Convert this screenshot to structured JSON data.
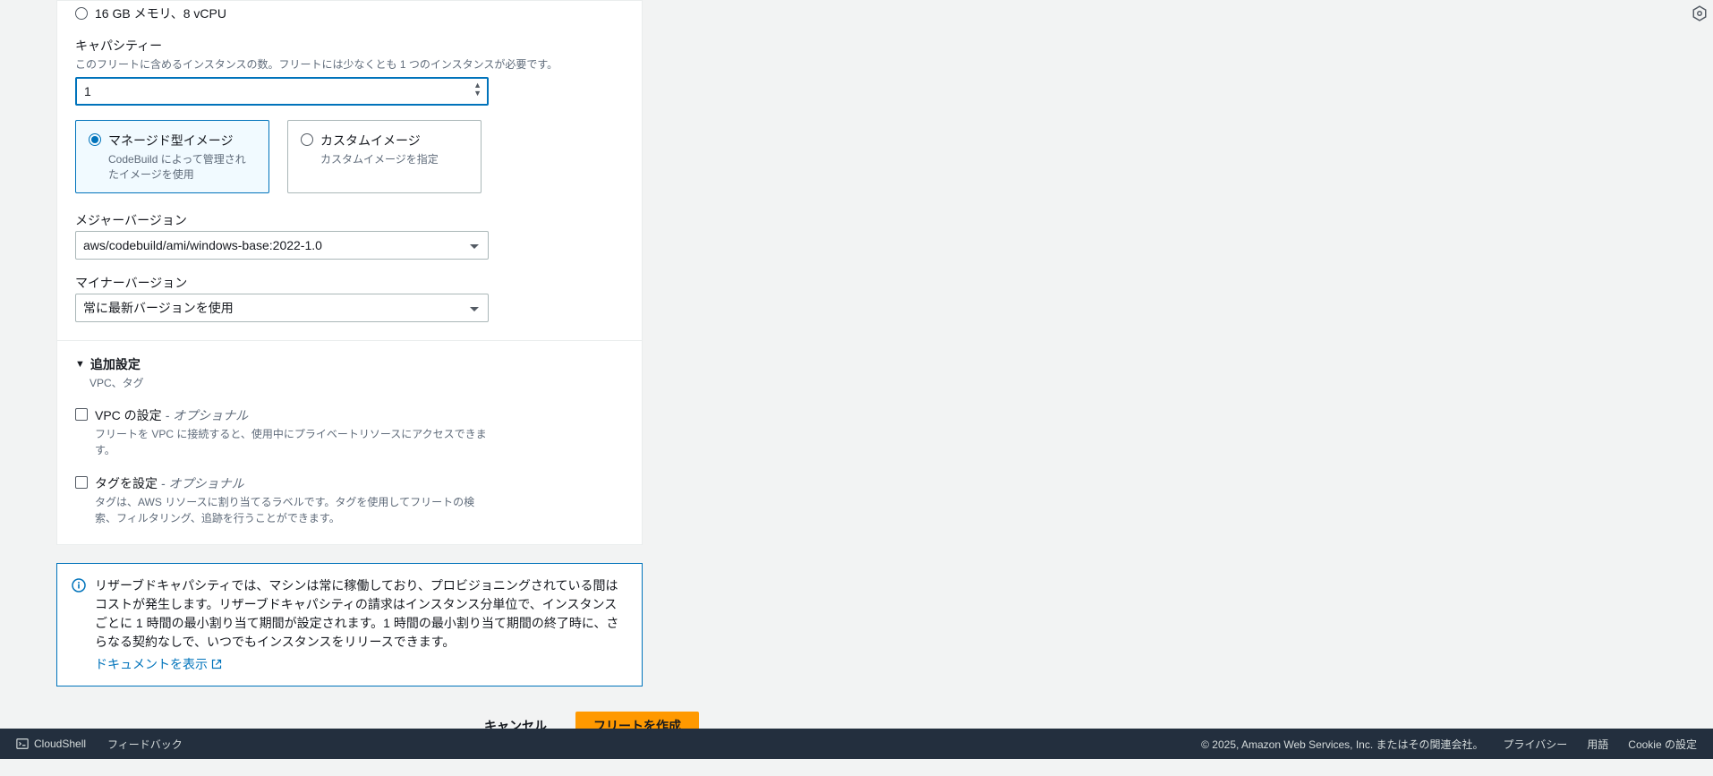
{
  "memory_option": "16 GB メモリ、8 vCPU",
  "capacity": {
    "label": "キャパシティー",
    "hint": "このフリートに含めるインスタンスの数。フリートには少なくとも 1 つのインスタンスが必要です。",
    "value": "1"
  },
  "image_tiles": {
    "managed": {
      "title": "マネージド型イメージ",
      "desc": "CodeBuild によって管理されたイメージを使用"
    },
    "custom": {
      "title": "カスタムイメージ",
      "desc": "カスタムイメージを指定"
    }
  },
  "major": {
    "label": "メジャーバージョン",
    "value": "aws/codebuild/ami/windows-base:2022-1.0"
  },
  "minor": {
    "label": "マイナーバージョン",
    "value": "常に最新バージョンを使用"
  },
  "additional": {
    "title": "追加設定",
    "sub": "VPC、タグ"
  },
  "vpc": {
    "label": "VPC の設定",
    "optional": " - オプショナル",
    "desc": "フリートを VPC に接続すると、使用中にプライベートリソースにアクセスできます。"
  },
  "tags": {
    "label": "タグを設定",
    "optional": " - オプショナル",
    "desc": "タグは、AWS リソースに割り当てるラベルです。タグを使用してフリートの検索、フィルタリング、追跡を行うことができます。"
  },
  "info": {
    "text": "リザーブドキャパシティでは、マシンは常に稼働しており、プロビジョニングされている間はコストが発生します。リザーブドキャパシティの請求はインスタンス分単位で、インスタンスごとに 1 時間の最小割り当て期間が設定されます。1 時間の最小割り当て期間の終了時に、さらなる契約なしで、いつでもインスタンスをリリースできます。",
    "link": "ドキュメントを表示"
  },
  "buttons": {
    "cancel": "キャンセル",
    "create": "フリートを作成"
  },
  "footer": {
    "cloudshell": "CloudShell",
    "feedback": "フィードバック",
    "copyright": "© 2025, Amazon Web Services, Inc. またはその関連会社。",
    "privacy": "プライバシー",
    "terms": "用語",
    "cookie": "Cookie の設定"
  }
}
